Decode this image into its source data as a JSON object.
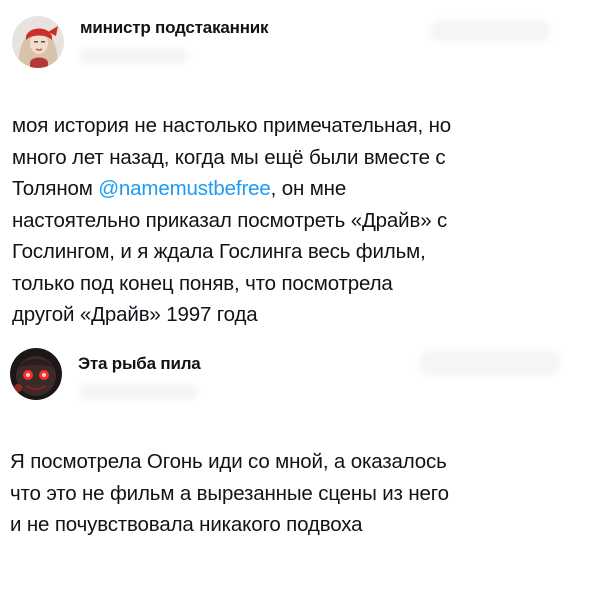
{
  "posts": [
    {
      "author": "министр подстаканник",
      "avatar_icon": "woman-red-headband-avatar",
      "lines": [
        "моя история не настолько примечательная, но",
        "много лет назад, когда мы ещё были вместе с",
        [
          "Толяном ",
          "@namemustbefree",
          ", он мне"
        ],
        "настоятельно приказал посмотреть «Драйв» с",
        "Гослингом, и я ждала Гослинга весь фильм,",
        "только под конец поняв, что посмотрела",
        "другой «Драйв» 1997 года"
      ]
    },
    {
      "author": "Эта рыба пила",
      "avatar_icon": "dark-creature-red-eyes-avatar",
      "lines": [
        "Я посмотрела Огонь иди со мной, а оказалось",
        "что это не фильм а вырезанные сцены из него",
        "и не почувствовала никакого подвоха"
      ]
    }
  ],
  "colors": {
    "text": "#0f1419",
    "mention": "#1d9bf0",
    "background": "#ffffff"
  }
}
